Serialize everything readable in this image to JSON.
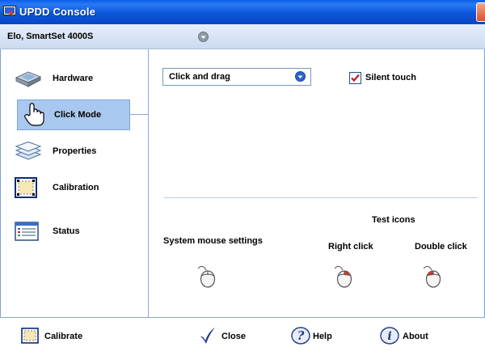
{
  "window": {
    "title": "UPDD Console"
  },
  "device": {
    "selected": "Elo, SmartSet 4000S"
  },
  "sidebar": {
    "items": [
      {
        "label": "Hardware",
        "icon": "hardware-icon"
      },
      {
        "label": "Click Mode",
        "icon": "hand-pointer-icon",
        "selected": true
      },
      {
        "label": "Properties",
        "icon": "layers-icon"
      },
      {
        "label": "Calibration",
        "icon": "calibration-icon"
      },
      {
        "label": "Status",
        "icon": "status-icon"
      }
    ]
  },
  "main": {
    "click_mode": {
      "selected": "Click and drag"
    },
    "silent_touch": {
      "label": "Silent touch",
      "checked": true
    },
    "test_icons": {
      "heading": "Test icons",
      "system_mouse_label": "System mouse settings",
      "right_click_label": "Right click",
      "double_click_label": "Double click"
    }
  },
  "footer": {
    "calibrate_label": "Calibrate",
    "close_label": "Close",
    "help_label": "Help",
    "about_label": "About"
  },
  "colors": {
    "titlebar": "#0b56d8",
    "selection": "#a9c8f0",
    "checkmark": "#c0182a"
  }
}
